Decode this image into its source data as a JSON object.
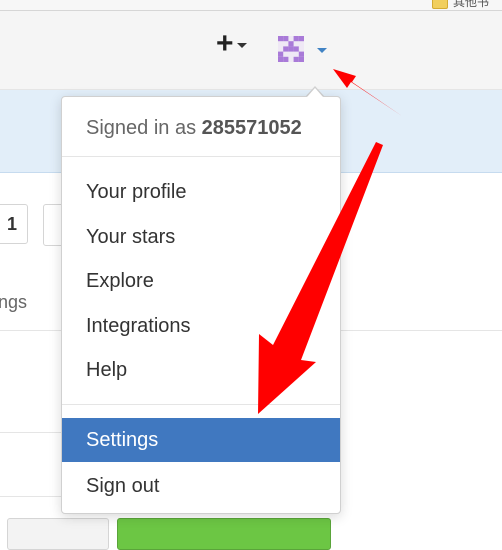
{
  "bookmark_bar": {
    "folder_label": "其他书"
  },
  "header": {
    "new_button_icon": "plus-icon",
    "avatar_icon": "identicon-avatar",
    "avatar_color": "#a97ad8",
    "caret_color": "#4183c4"
  },
  "background_page": {
    "page_number": "1",
    "settings_tab_fragment": "ngs"
  },
  "dropdown": {
    "signed_in_prefix": "Signed in as ",
    "username": "285571052",
    "items": [
      {
        "label": "Your profile"
      },
      {
        "label": "Your stars"
      },
      {
        "label": "Explore"
      },
      {
        "label": "Integrations"
      },
      {
        "label": "Help"
      },
      {
        "label": "Settings",
        "highlighted": true
      },
      {
        "label": "Sign out"
      }
    ],
    "highlight_color": "#4078c0"
  },
  "annotation": {
    "arrow_color": "#ff0000"
  }
}
